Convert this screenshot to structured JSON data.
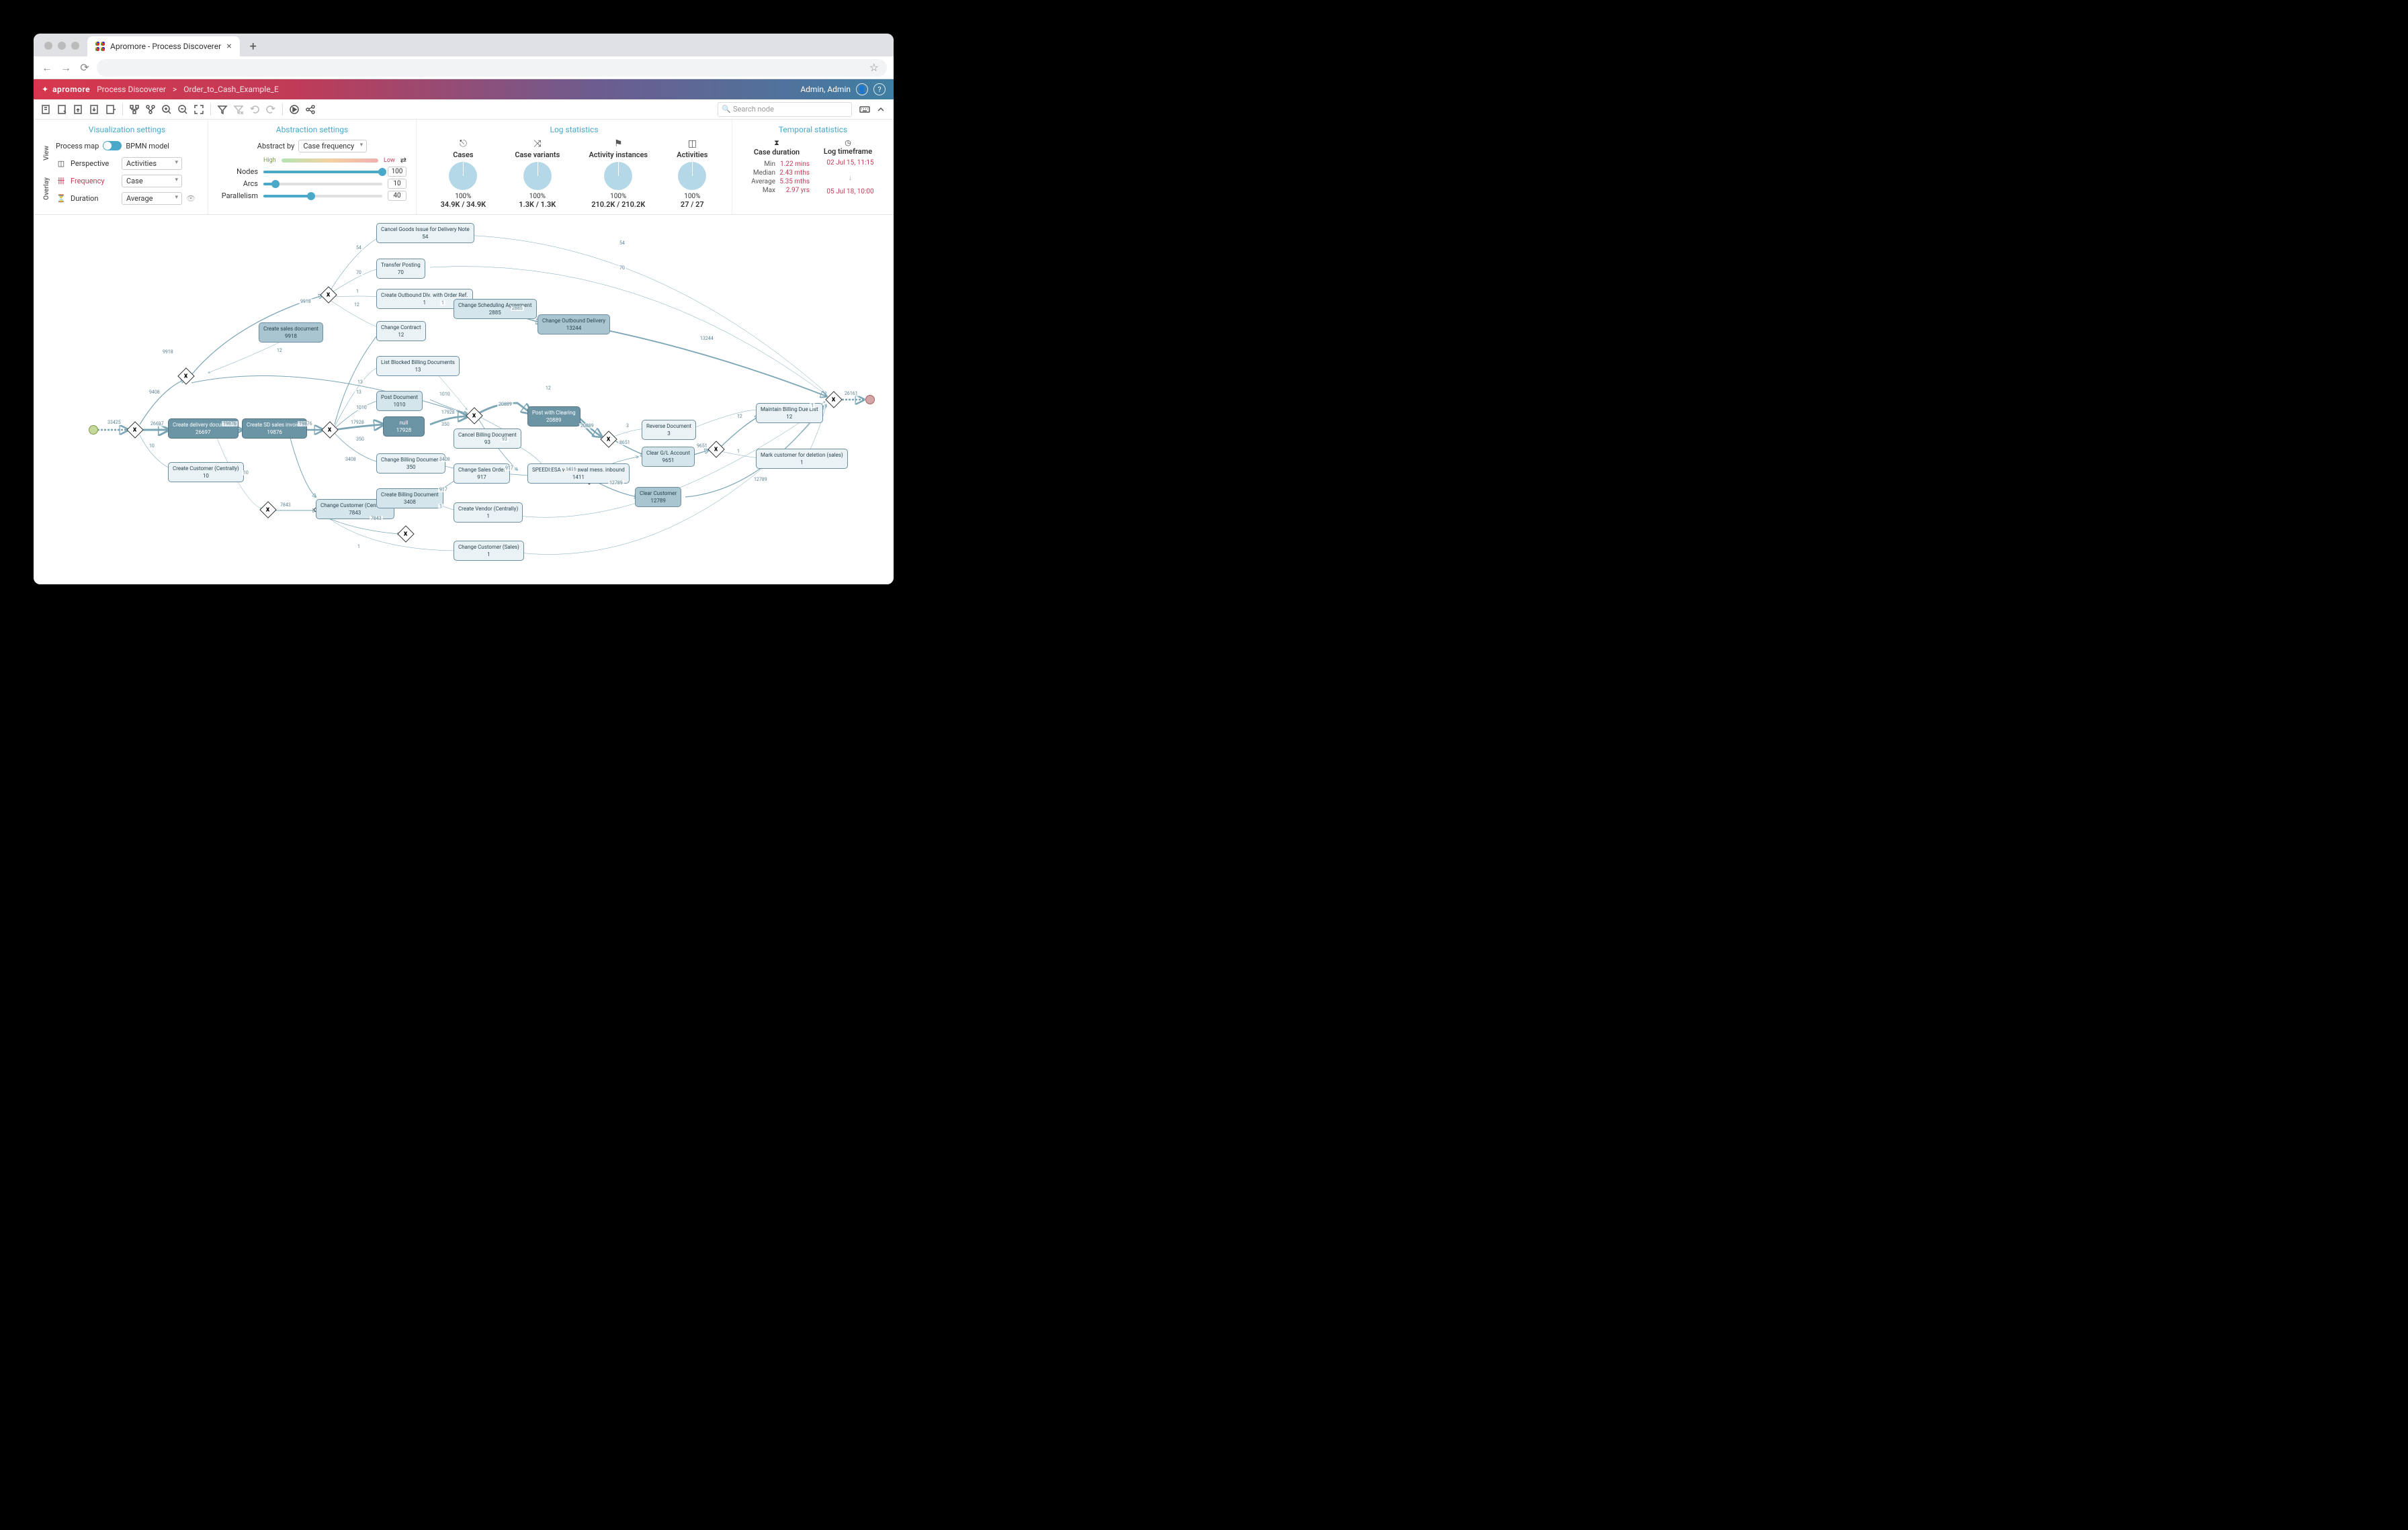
{
  "browser": {
    "tab_title": "Apromore - Process Discoverer",
    "star_icon": "☆"
  },
  "header": {
    "brand": "apromore",
    "app": "Process Discoverer",
    "sep": ">",
    "file": "Order_to_Cash_Example_E",
    "user": "Admin, Admin"
  },
  "toolbar": {
    "search_placeholder": "Search node"
  },
  "viz": {
    "title": "Visualization settings",
    "view_label": "View",
    "overlay_label": "Overlay",
    "process_map": "Process map",
    "bpmn_model": "BPMN model",
    "perspective": "Perspective",
    "perspective_val": "Activities",
    "frequency": "Frequency",
    "frequency_val": "Case",
    "duration": "Duration",
    "duration_val": "Average"
  },
  "abs": {
    "title": "Abstraction settings",
    "abstract_by": "Abstract by",
    "abstract_val": "Case frequency",
    "high": "High",
    "low": "Low",
    "nodes": "Nodes",
    "nodes_val": "100",
    "arcs": "Arcs",
    "arcs_val": "10",
    "para": "Parallelism",
    "para_val": "40"
  },
  "log": {
    "title": "Log statistics",
    "cases": "Cases",
    "cases_pct": "100%",
    "cases_val": "34.9K / 34.9K",
    "variants": "Case variants",
    "variants_pct": "100%",
    "variants_val": "1.3K / 1.3K",
    "ai": "Activity instances",
    "ai_pct": "100%",
    "ai_val": "210.2K / 210.2K",
    "acts": "Activities",
    "acts_pct": "100%",
    "acts_val": "27 / 27"
  },
  "temp": {
    "title": "Temporal statistics",
    "cd": "Case duration",
    "lt": "Log timeframe",
    "min_l": "Min",
    "min_v": "1.22 mins",
    "med_l": "Median",
    "med_v": "2.43 mths",
    "avg_l": "Average",
    "avg_v": "5.35 mths",
    "max_l": "Max",
    "max_v": "2.97 yrs",
    "lt_start": "02 Jul 15, 11:15",
    "lt_end": "05 Jul 18, 10:00"
  },
  "nodes": {
    "n1": {
      "t": "Create delivery document",
      "c": "26697"
    },
    "n2": {
      "t": "Create sales document",
      "c": "9918"
    },
    "n3": {
      "t": "Create Customer (Centrally)",
      "c": "10"
    },
    "n4": {
      "t": "Create SD sales invoice",
      "c": "19876"
    },
    "n5": {
      "t": "Change Customer (Centrally)",
      "c": "7843"
    },
    "n6": {
      "t": "Cancel Goods Issue for Delivery Note",
      "c": "54"
    },
    "n7": {
      "t": "Transfer Posting",
      "c": "70"
    },
    "n8": {
      "t": "Create Outbound Dlv. with Order Ref.",
      "c": "1"
    },
    "n9": {
      "t": "Change Contract",
      "c": "12"
    },
    "n10": {
      "t": "List Blocked Billing Documents",
      "c": "13"
    },
    "n11": {
      "t": "Post Document",
      "c": "1010"
    },
    "n12": {
      "t": "null",
      "c": "17928"
    },
    "n13": {
      "t": "Change Billing Document",
      "c": "350"
    },
    "n14": {
      "t": "Create Billing Document",
      "c": "3408"
    },
    "n15": {
      "t": "Change Scheduling Agreement",
      "c": "2885"
    },
    "n16": {
      "t": "Change Outbound Delivery",
      "c": "13244"
    },
    "n17": {
      "t": "Cancel Billing Document",
      "c": "93"
    },
    "n18": {
      "t": "Change Sales Order",
      "c": "917"
    },
    "n19": {
      "t": "Create Vendor (Centrally)",
      "c": "1"
    },
    "n20": {
      "t": "Change Customer (Sales)",
      "c": "1"
    },
    "n21": {
      "t": "Post with Clearing",
      "c": "20889"
    },
    "n22": {
      "t": "SPEEDI:ESA withdrawal mess. inbound",
      "c": "1411"
    },
    "n23": {
      "t": "Reverse Document",
      "c": "3"
    },
    "n24": {
      "t": "Clear G/L Account",
      "c": "9651"
    },
    "n25": {
      "t": "Clear Customer",
      "c": "12789"
    },
    "n26": {
      "t": "Maintain Billing Due List",
      "c": "12"
    },
    "n27": {
      "t": "Mark customer for deletion (sales)",
      "c": "1"
    }
  },
  "edges": {
    "e_start": "33425",
    "e1": "26697",
    "e2": "9918",
    "e3": "10",
    "e4": "19876",
    "e5": "9408",
    "e6": "7843",
    "e7": "54",
    "e8": "70",
    "e9": "1",
    "e10": "12",
    "e11": "13",
    "e12": "1010",
    "e13": "17928",
    "e14": "350",
    "e15": "3408",
    "e16": "2885",
    "e17": "13244",
    "e18": "93",
    "e19": "917",
    "e20": "1",
    "e21": "20889",
    "e22": "1411",
    "e23": "3",
    "e24": "9651",
    "e25": "12789",
    "e26": "12",
    "e27": "1",
    "e_end": "26161",
    "e28": "10",
    "e29": "1010",
    "e30": "19876",
    "e31": "7843",
    "e32": "20889",
    "e33": "8651",
    "e34": "9651",
    "e35": "917",
    "e36": "12",
    "e37": "1",
    "e38": "1",
    "e39": "3408",
    "e40": "9918",
    "e41": "12789",
    "e42": "54",
    "e43": "70"
  }
}
